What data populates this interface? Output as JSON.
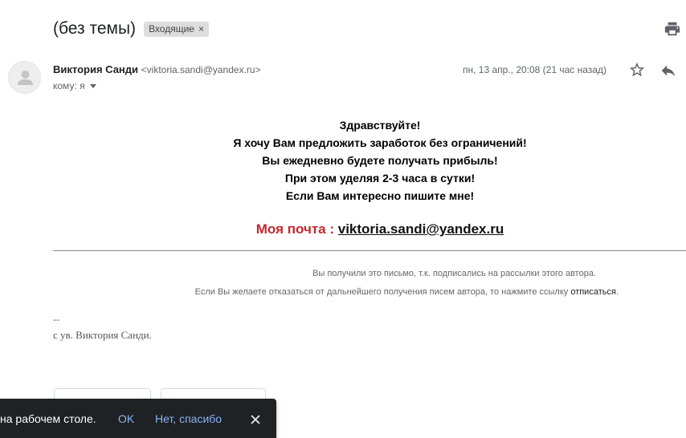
{
  "header": {
    "subject": "(без темы)",
    "label": "Входящие",
    "label_remove": "×"
  },
  "message": {
    "sender_name": "Виктория Санди",
    "sender_email": "<viktoria.sandi@yandex.ru>",
    "to_text": "кому: я",
    "date": "пн, 13 апр., 20:08 (21 час назад)"
  },
  "body": {
    "lines": [
      "Здравствуйте!",
      "Я хочу Вам предложить заработок без ограничений!",
      "Вы ежедневно будете получать прибыль!",
      "При этом уделяя 2-3 часа в сутки!",
      "Если Вам интересно пишите мне!"
    ],
    "mail_label": "Моя почта :",
    "mail_address": "viktoria.sandi@yandex.ru",
    "label_color": "#c0282d"
  },
  "footer": {
    "info1": "Вы получили это письмо, т.к. подписались на рассылки этого автора.",
    "info2_prefix": "Если Вы желаете отказаться от дальнейшего получения писем автора, то нажмите ссылку ",
    "unsubscribe_link": "отписаться",
    "info2_suffix": ".",
    "sig_dash": "--",
    "signature": "с ув. Виктория Санди."
  },
  "snackbar": {
    "text": "на рабочем столе.",
    "ok": "OK",
    "no_thanks": "Нет, спасибо"
  },
  "icons": {
    "print": "print-icon",
    "star": "star-icon",
    "reply": "reply-icon",
    "close": "close-icon",
    "avatar": "person-icon"
  }
}
